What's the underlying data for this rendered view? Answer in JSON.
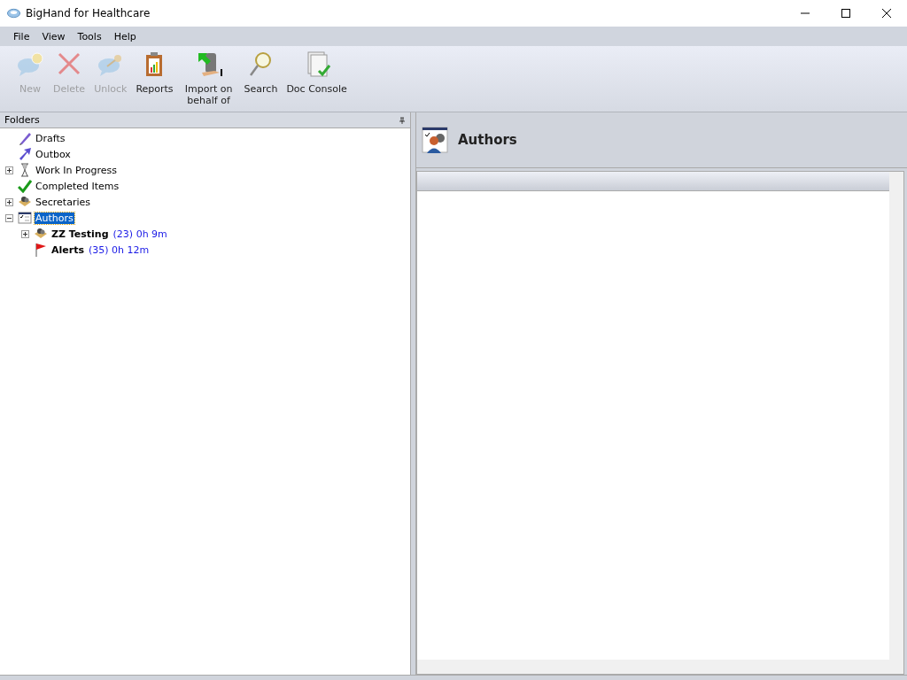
{
  "window": {
    "title": "BigHand for Healthcare"
  },
  "menu": [
    "File",
    "View",
    "Tools",
    "Help"
  ],
  "toolbar": [
    {
      "label": "New",
      "kind": "new",
      "disabled": true
    },
    {
      "label": "Delete",
      "kind": "delete",
      "disabled": true
    },
    {
      "label": "Unlock",
      "kind": "unlock",
      "disabled": true
    },
    {
      "label": "Reports",
      "kind": "reports",
      "disabled": false
    },
    {
      "label": "Import on behalf of",
      "kind": "import",
      "disabled": false
    },
    {
      "label": "Search",
      "kind": "search",
      "disabled": false
    },
    {
      "label": "Doc Console",
      "kind": "doc",
      "disabled": false
    }
  ],
  "folders": {
    "title": "Folders",
    "items": [
      {
        "label": "Drafts",
        "kind": "pencil",
        "selected": false
      },
      {
        "label": "Outbox",
        "kind": "arrow",
        "selected": false
      },
      {
        "label": "Work In Progress",
        "kind": "hourglass",
        "selected": false,
        "expanded": false
      },
      {
        "label": "Completed Items",
        "kind": "check",
        "selected": false
      },
      {
        "label": "Secretaries",
        "kind": "group",
        "selected": false,
        "expanded": false
      },
      {
        "label": "Authors",
        "kind": "list",
        "selected": true,
        "expanded": true,
        "children": [
          {
            "label": "ZZ Testing",
            "count": "(23) 0h 9m",
            "kind": "group",
            "selected": false,
            "expanded": false
          },
          {
            "label": "Alerts",
            "count": "(35) 0h 12m",
            "kind": "flag",
            "selected": false
          }
        ]
      }
    ]
  },
  "content": {
    "title": "Authors"
  }
}
